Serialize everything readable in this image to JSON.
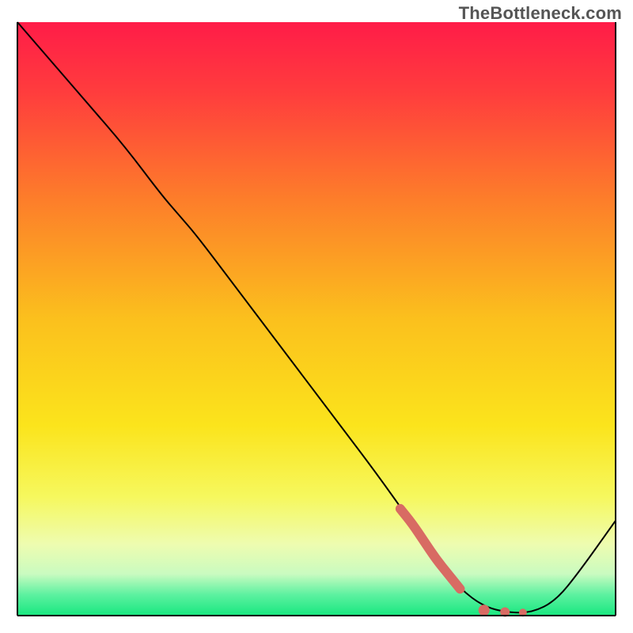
{
  "watermark": "TheBottleneck.com",
  "chart_data": {
    "type": "line",
    "title": "",
    "xlabel": "",
    "ylabel": "",
    "xlim": [
      0,
      100
    ],
    "ylim": [
      0,
      100
    ],
    "grid": false,
    "legend": false,
    "background": {
      "type": "vertical-gradient",
      "stops": [
        {
          "pos": 0.0,
          "color": "#ff1c48"
        },
        {
          "pos": 0.12,
          "color": "#ff3d3d"
        },
        {
          "pos": 0.3,
          "color": "#fd7e2a"
        },
        {
          "pos": 0.5,
          "color": "#fbc01d"
        },
        {
          "pos": 0.68,
          "color": "#fbe41c"
        },
        {
          "pos": 0.8,
          "color": "#f6f85e"
        },
        {
          "pos": 0.88,
          "color": "#eefcb0"
        },
        {
          "pos": 0.93,
          "color": "#c9fbc0"
        },
        {
          "pos": 0.965,
          "color": "#5cf1a0"
        },
        {
          "pos": 1.0,
          "color": "#18e77f"
        }
      ]
    },
    "series": [
      {
        "name": "bottleneck-curve",
        "color": "#000000",
        "stroke_width": 2,
        "x": [
          0,
          6,
          12,
          18,
          24,
          27,
          30,
          36,
          42,
          48,
          54,
          60,
          66,
          70,
          74,
          78,
          82,
          86,
          90,
          94,
          100
        ],
        "y": [
          100,
          93,
          86,
          79,
          71,
          67.5,
          64,
          56,
          48,
          40,
          32,
          24,
          15.5,
          9.5,
          4.5,
          1.5,
          0.5,
          0.5,
          2.5,
          7.5,
          16
        ]
      },
      {
        "name": "highlight-segment",
        "color": "#d86b63",
        "stroke_width": 12,
        "linecap": "round",
        "x": [
          64,
          66,
          68,
          70,
          72,
          74
        ],
        "y": [
          18,
          15.5,
          12.5,
          9.5,
          7,
          4.5
        ]
      },
      {
        "name": "highlight-dot-1",
        "type": "scatter",
        "color": "#d86b63",
        "radius": 7,
        "x": [
          78
        ],
        "y": [
          0.9
        ]
      },
      {
        "name": "highlight-dot-2",
        "type": "scatter",
        "color": "#d86b63",
        "radius": 6,
        "x": [
          81.5
        ],
        "y": [
          0.6
        ]
      },
      {
        "name": "highlight-dot-3",
        "type": "scatter",
        "color": "#d86b63",
        "radius": 5,
        "x": [
          84.5
        ],
        "y": [
          0.5
        ]
      }
    ],
    "frame": {
      "left": true,
      "right": true,
      "bottom": true,
      "top": false,
      "color": "#000000",
      "width": 2
    }
  }
}
